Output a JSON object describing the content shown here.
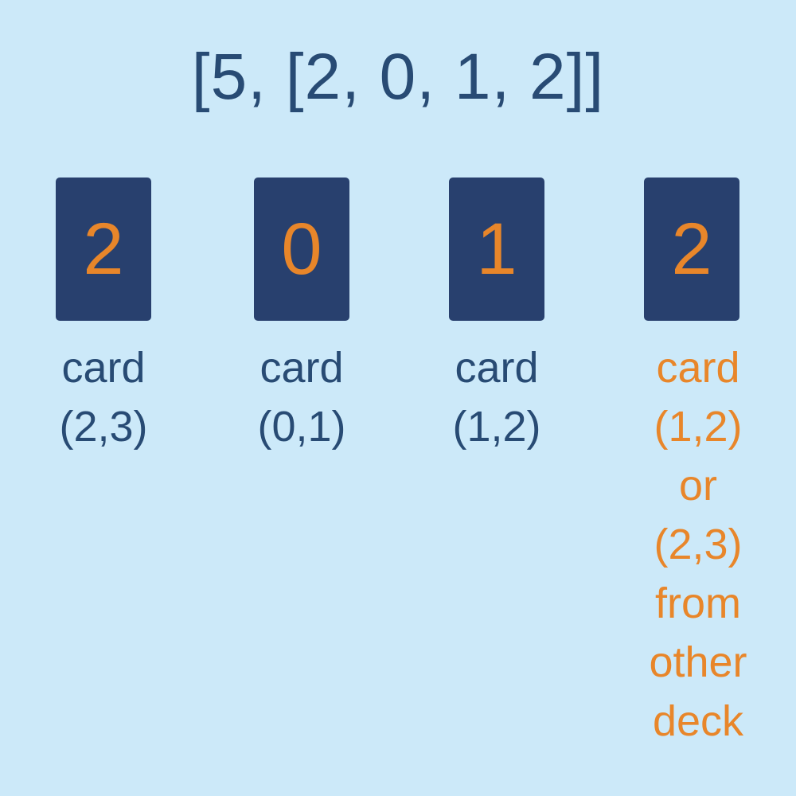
{
  "title": "[5, [2, 0, 1, 2]]",
  "colors": {
    "background": "#cce9f9",
    "card": "#28406e",
    "text": "#284b74",
    "accent": "#e8862a"
  },
  "cards": [
    {
      "value": "2",
      "caption": [
        "card",
        "(2,3)"
      ]
    },
    {
      "value": "0",
      "caption": [
        "card",
        "(0,1)"
      ]
    },
    {
      "value": "1",
      "caption": [
        "card",
        "(1,2)"
      ]
    },
    {
      "value": "2",
      "caption": [
        "card",
        "(1,2)",
        "or",
        "(2,3)",
        "from",
        "other",
        "deck"
      ]
    }
  ]
}
